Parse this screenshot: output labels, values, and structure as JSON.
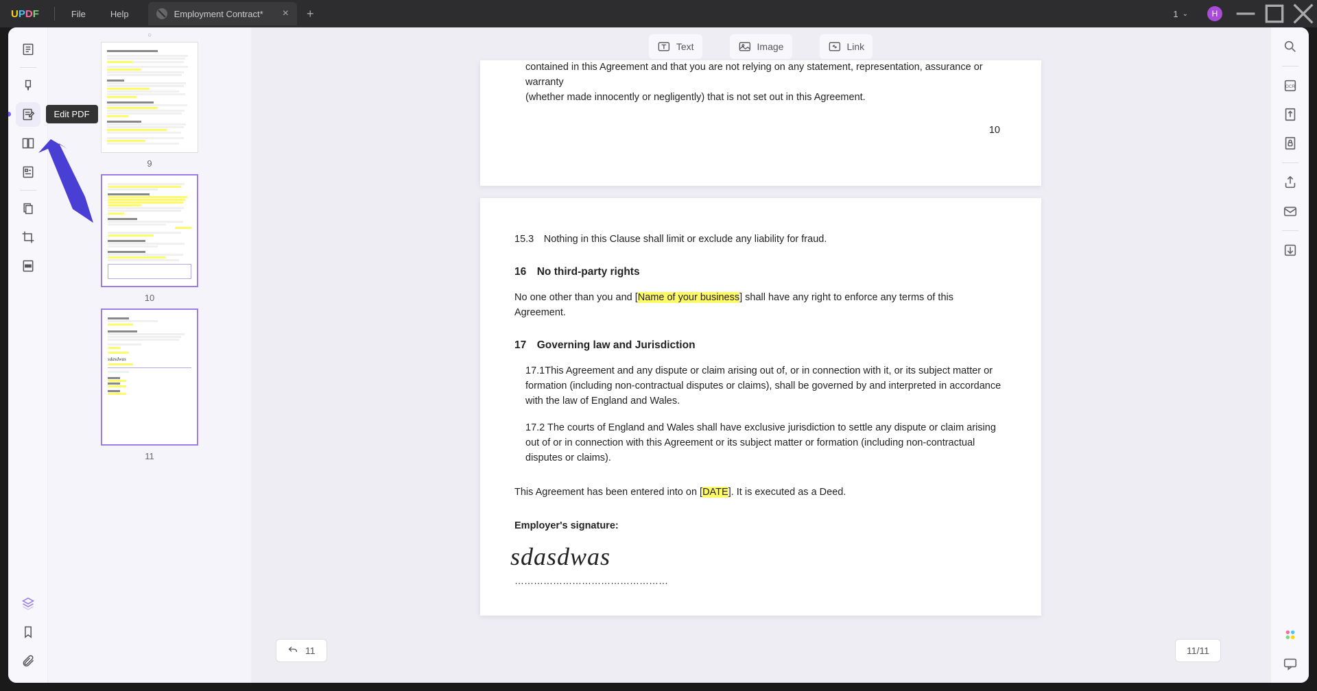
{
  "titlebar": {
    "menu_file": "File",
    "menu_help": "Help",
    "tab_title": "Employment Contract*",
    "page_indicator": "1",
    "avatar_letter": "H"
  },
  "tooltip_edit": "Edit PDF",
  "edit_toolbar": {
    "text": "Text",
    "image": "Image",
    "link": "Link"
  },
  "thumbs": {
    "p9": "9",
    "p10": "10",
    "p11": "11"
  },
  "doc": {
    "p1_line1": "contained in this Agreement and that you are not relying on any statement, representation, assurance or warranty",
    "p1_line2": "(whether made innocently or negligently) that is not set out in this Agreement.",
    "p1_pagenum": "10",
    "c15_3": "15.3 Nothing in this Clause shall limit or exclude any liability for fraud.",
    "h16": "16 No third-party rights",
    "c16_pre": "No one other than you and [",
    "c16_hl": "Name of your business",
    "c16_post": "] shall have any right to enforce any terms of this Agreement.",
    "h17": "17 Governing law and Jurisdiction",
    "c17_1": "17.1This Agreement and any dispute or claim arising out of, or in connection with it, or its subject matter or formation (including non-contractual disputes or claims), shall be governed by and interpreted in accordance with the law of England and Wales.",
    "c17_2": "17.2 The courts of England and Wales shall have exclusive jurisdiction to settle any dispute or claim arising out of or in connection with this Agreement or its subject matter or formation (including non-contractual disputes or claims).",
    "entered_pre": "This Agreement has been entered into on [",
    "entered_hl": "DATE",
    "entered_post": "]. It is executed as a Deed.",
    "sig_label": "Employer's signature:",
    "signature": "sdasdwas",
    "sig_dots": "…………………………………………"
  },
  "undo_count": "11",
  "page_counter": "11/11"
}
